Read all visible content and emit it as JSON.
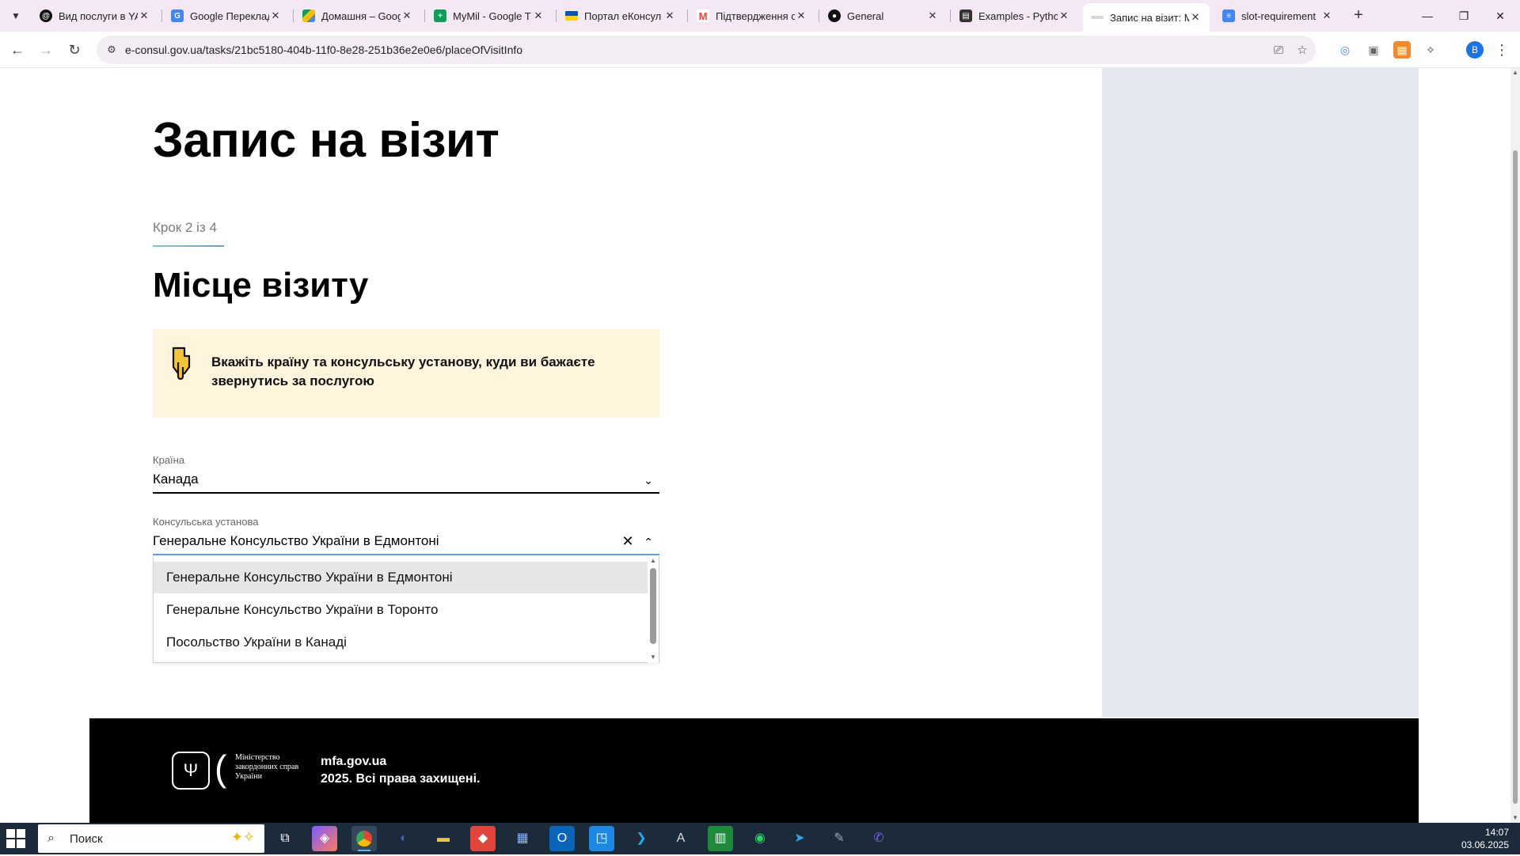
{
  "browser": {
    "tabs": [
      {
        "title": "Вид послуги в YA",
        "icon": "threads-icon",
        "color": "#000000"
      },
      {
        "title": "Google Перекладач",
        "icon": "translate-icon",
        "color": "#4285f4"
      },
      {
        "title": "Домашня – Goog",
        "icon": "drive-icon",
        "color": "#fbbc04"
      },
      {
        "title": "MyMil - Google T",
        "icon": "sheets-icon",
        "color": "#0f9d58"
      },
      {
        "title": "Портал еКонсул",
        "icon": "ua-flag-icon",
        "color": "#ffd500"
      },
      {
        "title": "Підтвердження с",
        "icon": "gmail-icon",
        "color": "#ea4335"
      },
      {
        "title": "General",
        "icon": "github-icon",
        "color": "#111111"
      },
      {
        "title": "Examples - Pytho",
        "icon": "examples-icon",
        "color": "#333333"
      },
      {
        "title": "Запис на візит: М",
        "icon": "econsul-icon",
        "color": "#aaaaaa",
        "active": true
      },
      {
        "title": "slot-requirement",
        "icon": "docs-icon",
        "color": "#4285f4"
      }
    ],
    "url": "e-consul.gov.ua/tasks/21bc5180-404b-11f0-8e28-251b36e2e0e6/placeOfVisitInfo",
    "profile_initial": "B"
  },
  "page": {
    "title": "Запис на візит",
    "step": "Крок 2 із 4",
    "section_title": "Місце візиту",
    "notice": "Вкажіть країну та консульську установу, куди ви бажаєте звернутись за послугою",
    "country": {
      "label": "Країна",
      "value": "Канада"
    },
    "consulate": {
      "label": "Консульська установа",
      "value": "Генеральне Консульство України в Едмонтоні",
      "options": [
        "Генеральне Консульство України в Едмонтоні",
        "Генеральне Консульство України в Торонто",
        "Посольство України в Канаді"
      ],
      "highlighted_index": 0
    },
    "footer": {
      "ministry": "Міністерство закордонних справ України",
      "site": "mfa.gov.ua",
      "rights": "2025. Всі права захищені."
    }
  },
  "taskbar": {
    "search_placeholder": "Поиск",
    "time": "14:07",
    "date": "03.06.2025"
  }
}
